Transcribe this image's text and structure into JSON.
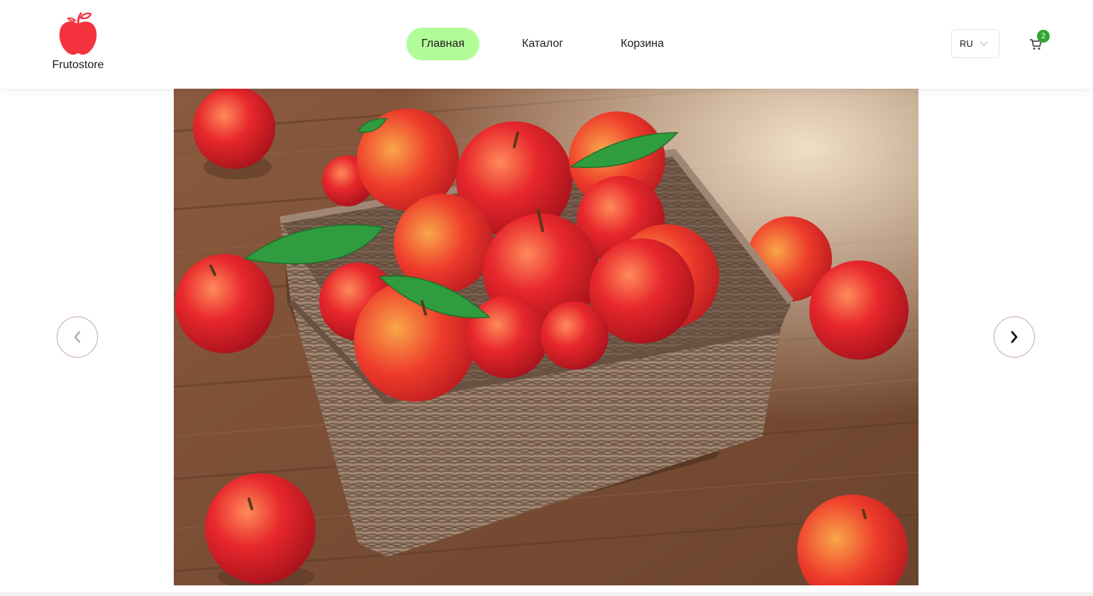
{
  "brand": {
    "name": "Frutostore",
    "logo_icon": "apple-icon",
    "logo_color": "#f4333f"
  },
  "nav": {
    "items": [
      {
        "label": "Главная",
        "active": true
      },
      {
        "label": "Каталог",
        "active": false
      },
      {
        "label": "Корзина",
        "active": false
      }
    ],
    "active_color": "#b3fc9a"
  },
  "language": {
    "selected": "RU",
    "icon": "chevron-down-icon"
  },
  "cart": {
    "icon": "cart-icon",
    "count": "2",
    "badge_color": "#2fa52f"
  },
  "slider": {
    "image_subject": "apples-in-wicker-basket",
    "prev_icon": "chevron-left-icon",
    "next_icon": "chevron-right-icon"
  }
}
